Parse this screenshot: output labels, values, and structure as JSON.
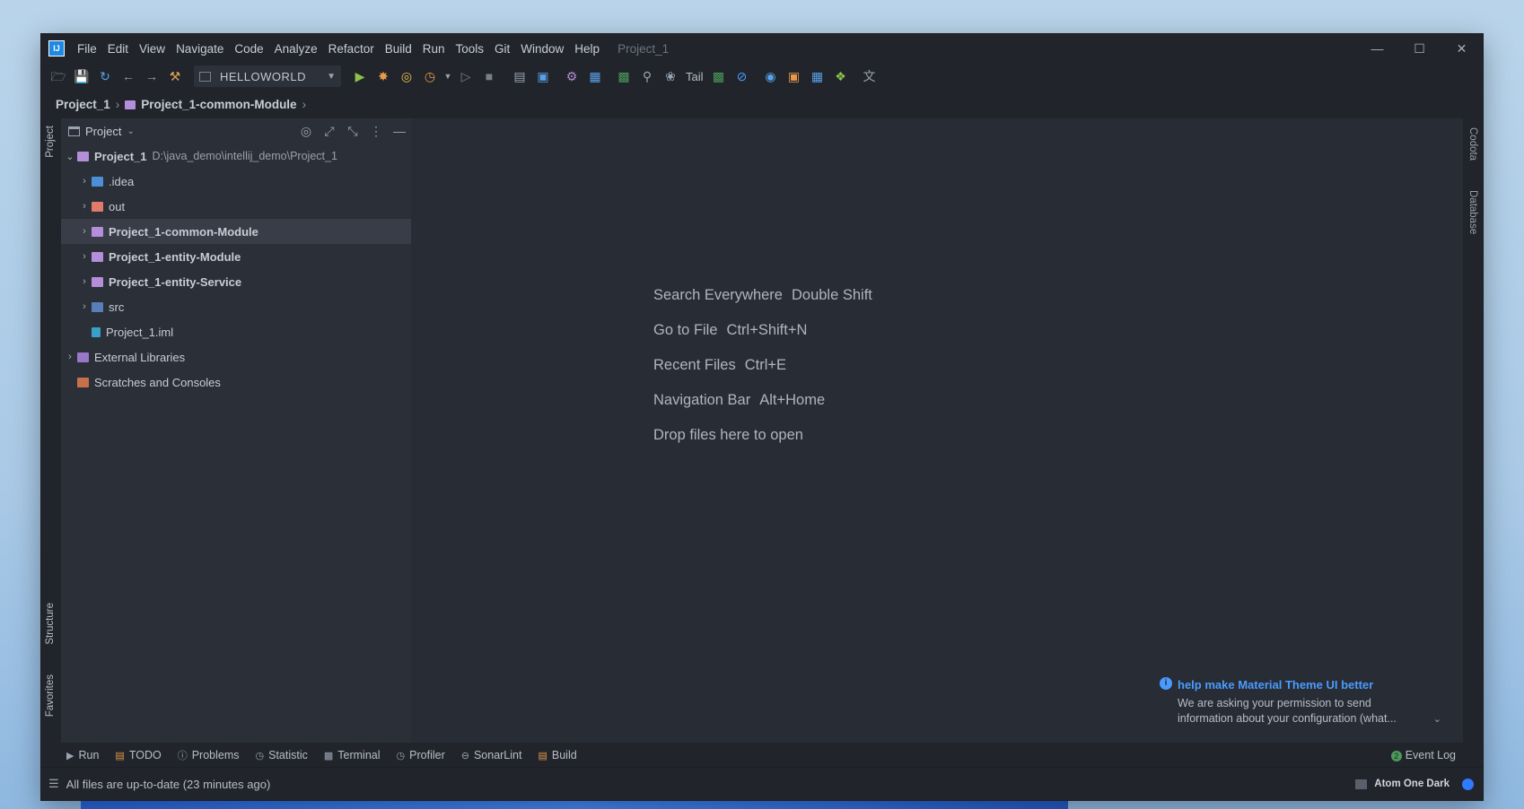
{
  "menu": {
    "items": [
      "File",
      "Edit",
      "View",
      "Navigate",
      "Code",
      "Analyze",
      "Refactor",
      "Build",
      "Run",
      "Tools",
      "Git",
      "Window",
      "Help"
    ],
    "project_title": "Project_1"
  },
  "toolbar": {
    "run_config": "HELLOWORLD",
    "tail_label": "Tail"
  },
  "breadcrumb": {
    "root": "Project_1",
    "module": "Project_1-common-Module"
  },
  "side": {
    "project_label": "Project",
    "structure_label": "Structure",
    "favorites_label": "Favorites",
    "codota_label": "Codota",
    "database_label": "Database"
  },
  "project_panel": {
    "title": "Project",
    "root_name": "Project_1",
    "root_path": "D:\\java_demo\\intellij_demo\\Project_1",
    "items": [
      {
        "label": ".idea"
      },
      {
        "label": "out"
      },
      {
        "label": "Project_1-common-Module"
      },
      {
        "label": "Project_1-entity-Module"
      },
      {
        "label": "Project_1-entity-Service"
      },
      {
        "label": "src"
      },
      {
        "label": "Project_1.iml"
      }
    ],
    "external_libraries": "External Libraries",
    "scratches": "Scratches and Consoles"
  },
  "editor": {
    "hints": [
      {
        "action": "Search Everywhere",
        "key": "Double Shift"
      },
      {
        "action": "Go to File",
        "key": "Ctrl+Shift+N"
      },
      {
        "action": "Recent Files",
        "key": "Ctrl+E"
      },
      {
        "action": "Navigation Bar",
        "key": "Alt+Home"
      },
      {
        "action": "Drop files here to open",
        "key": ""
      }
    ]
  },
  "notification": {
    "title": "help make Material Theme UI better",
    "body": "We are asking your permission to send information about your configuration (what..."
  },
  "bottom_tabs": {
    "run": "Run",
    "todo": "TODO",
    "problems": "Problems",
    "statistic": "Statistic",
    "terminal": "Terminal",
    "profiler": "Profiler",
    "sonarlint": "SonarLint",
    "build": "Build",
    "event_log": "Event Log",
    "event_count": "2"
  },
  "status": {
    "message": "All files are up-to-date (23 minutes ago)",
    "theme": "Atom One Dark"
  }
}
